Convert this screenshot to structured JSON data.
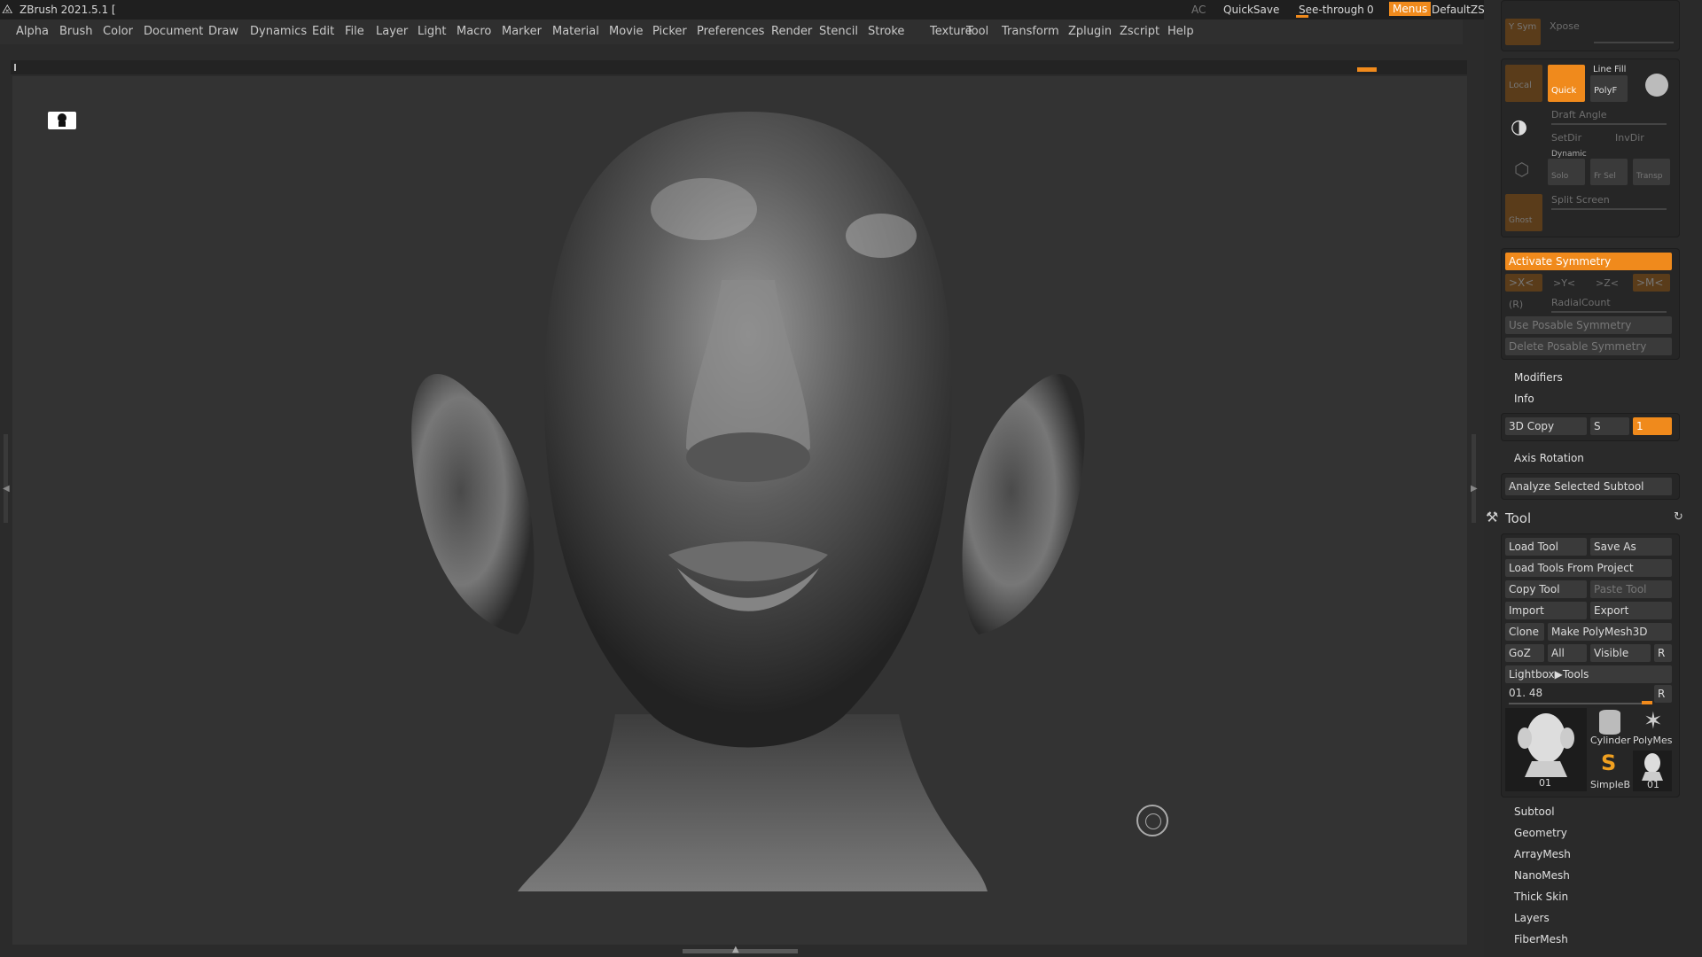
{
  "titlebar": {
    "app_title": "ZBrush 2021.5.1 [",
    "ac": "AC",
    "quicksave": "QuickSave",
    "see_through_label": "See-through",
    "see_through_value": "0",
    "menus": "Menus",
    "script": "DefaultZScript"
  },
  "menu": [
    "Alpha",
    "Brush",
    "Color",
    "Document",
    "Draw",
    "Dynamics",
    "Edit",
    "File",
    "Layer",
    "Light",
    "Macro",
    "Marker",
    "Material",
    "Movie",
    "Picker",
    "Preferences",
    "Render",
    "Stencil",
    "Stroke",
    "Texture",
    "Tool",
    "Transform",
    "Zplugin",
    "Zscript",
    "Help"
  ],
  "transform_panel": {
    "vsym": "Y Sym",
    "xpose": "Xpose",
    "local": "Local",
    "quick": "Quick",
    "line_fill": "Line Fill",
    "polyf": "PolyF",
    "draft_angle": "Draft Angle",
    "setdir": "SetDir",
    "invdir": "InvDir",
    "dynamic": "Dynamic",
    "solo": "Solo",
    "frsel": "Fr Sel",
    "transp": "Transp",
    "ghost": "Ghost",
    "split_screen": "Split Screen"
  },
  "symmetry": {
    "activate": "Activate Symmetry",
    "x": ">X<",
    "y": ">Y<",
    "z": ">Z<",
    "m": ">M<",
    "r": "(R)",
    "radial": "RadialCount",
    "use_posable": "Use Posable Symmetry",
    "delete_posable": "Delete Posable Symmetry"
  },
  "modifiers": "Modifiers",
  "info": "Info",
  "copy3d": {
    "label": "3D Copy",
    "s": "S",
    "value": "1"
  },
  "axis_rotation": "Axis Rotation",
  "analyze": "Analyze Selected Subtool",
  "tool": {
    "title": "Tool",
    "load_tool": "Load Tool",
    "save_as": "Save As",
    "load_from_project": "Load Tools From Project",
    "copy_tool": "Copy Tool",
    "paste_tool": "Paste Tool",
    "import": "Import",
    "export": "Export",
    "clone": "Clone",
    "make_polymesh": "Make PolyMesh3D",
    "goz": "GoZ",
    "all": "All",
    "visible": "Visible",
    "r": "R",
    "lightbox_tools": "Lightbox▶Tools",
    "current": "01. 48",
    "r2": "R",
    "thumbs": {
      "main": "01",
      "cylinder": "Cylinder",
      "polymesh": "PolyMes",
      "simpleb": "SimpleB",
      "small": "01"
    }
  },
  "subpanels": [
    "Subtool",
    "Geometry",
    "ArrayMesh",
    "NanoMesh",
    "Thick Skin",
    "Layers",
    "FiberMesh"
  ],
  "colors": {
    "accent": "#f08a1c",
    "bg": "#2b2b2b",
    "viewport": "#333333"
  }
}
